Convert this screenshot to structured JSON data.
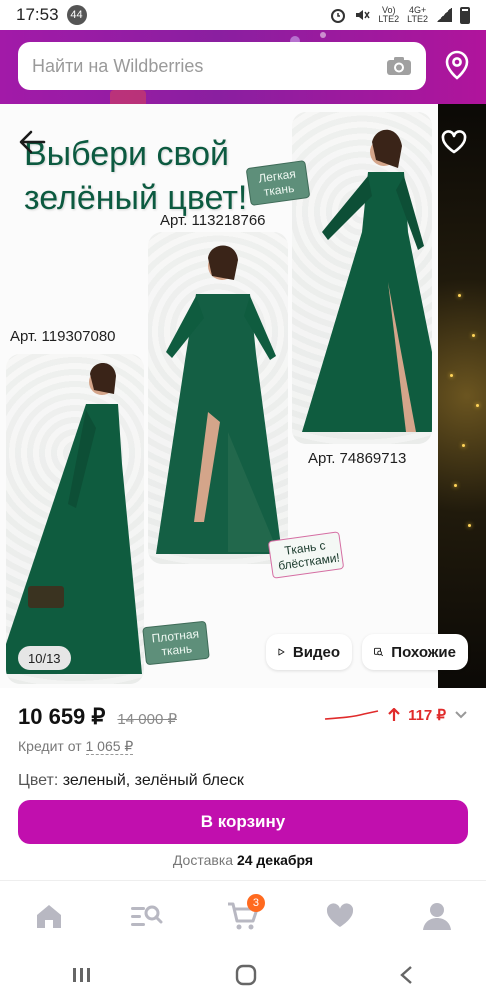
{
  "status_bar": {
    "time": "17:53",
    "notification_count": "44",
    "network_top": "Vo)",
    "network_bottom": "LTE2",
    "network_type_top": "4G+",
    "network_type_bottom": "LTE2"
  },
  "header": {
    "search_placeholder": "Найти на Wildberries",
    "accent_color": "#a21aa8"
  },
  "gallery": {
    "promo_title": "Выбери свой зелёный цвет!",
    "articles": [
      {
        "label": "Арт. 113218766"
      },
      {
        "label": "Арт. 119307080"
      },
      {
        "label": "Арт. 74869713"
      }
    ],
    "tags": {
      "light": "Легкая ткань",
      "dense": "Плотная ткань",
      "shine": "Ткань с блёстками!"
    },
    "counter": "10/13",
    "video_label": "Видео",
    "similar_label": "Похожие",
    "dress_color": "#0f5c3f"
  },
  "price": {
    "current": "10 659 ₽",
    "old": "14 000 ₽",
    "trend": "117 ₽",
    "trend_color": "#e02b2b",
    "credit_prefix": "Кредит от",
    "credit_amount": "1 065 ₽"
  },
  "color": {
    "label": "Цвет:",
    "value": "зеленый, зелёный блеск"
  },
  "cart_button": {
    "label": "В корзину",
    "color": "#c10fae"
  },
  "delivery": {
    "prefix": "Доставка",
    "date": "24 декабря"
  },
  "bottom_nav": {
    "items": [
      {
        "icon": "home-icon"
      },
      {
        "icon": "catalog-search-icon"
      },
      {
        "icon": "cart-icon",
        "badge": "3"
      },
      {
        "icon": "heart-icon"
      },
      {
        "icon": "profile-icon"
      }
    ]
  },
  "system_nav": {
    "icons": [
      "recents-icon",
      "home-circle-icon",
      "back-chevron-icon"
    ]
  }
}
